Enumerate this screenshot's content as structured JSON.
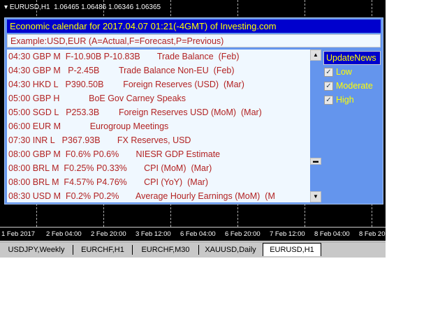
{
  "chart": {
    "symbol": "EURUSD,H1",
    "ohlc": "1.06465 1.06486 1.06346 1.06365",
    "time_labels": [
      "1 Feb 2017",
      "2 Feb 04:00",
      "2 Feb 20:00",
      "3 Feb 12:00",
      "6 Feb 04:00",
      "6 Feb 20:00",
      "7 Feb 12:00",
      "8 Feb 04:00",
      "8 Feb 20"
    ]
  },
  "calendar": {
    "title": "Economic calendar for 2017.04.07 01:21(-4GMT) of Investing.com",
    "example": "Example:USD,EUR    (A=Actual,F=Forecast,P=Previous)",
    "rows": [
      "04:30 GBP M  F-10.90B P-10.83B       Trade Balance  (Feb)",
      "04:30 GBP M   P-2.45B        Trade Balance Non-EU  (Feb)",
      "04:30 HKD L   P390.50B        Foreign Reserves (USD)  (Mar)",
      "05:00 GBP H            BoE Gov Carney Speaks",
      "05:00 SGD L   P253.3B        Foreign Reserves USD (MoM)  (Mar)",
      "06:00 EUR M            Eurogroup Meetings",
      "07:30 INR L   P367.93B       FX Reserves, USD",
      "08:00 GBP M  F0.6% P0.6%       NIESR GDP Estimate",
      "08:00 BRL M  F0.25% P0.33%       CPI (MoM)  (Mar)",
      "08:00 BRL M  F4.57% P4.76%       CPI (YoY)  (Mar)",
      "08:30 USD M  F0.2% P0.2%       Average Hourly Earnings (MoM)  (M"
    ],
    "update_label": "UpdateNews",
    "filters": [
      {
        "label": "Low",
        "checked": true
      },
      {
        "label": "Moderate",
        "checked": true
      },
      {
        "label": "High",
        "checked": true
      }
    ]
  },
  "tabs": [
    {
      "label": "USDJPY,Weekly"
    },
    {
      "label": "EURCHF,H1"
    },
    {
      "label": "EURCHF,M30"
    },
    {
      "label": "XAUUSD,Daily"
    },
    {
      "label": "EURUSD,H1",
      "active": true
    }
  ]
}
